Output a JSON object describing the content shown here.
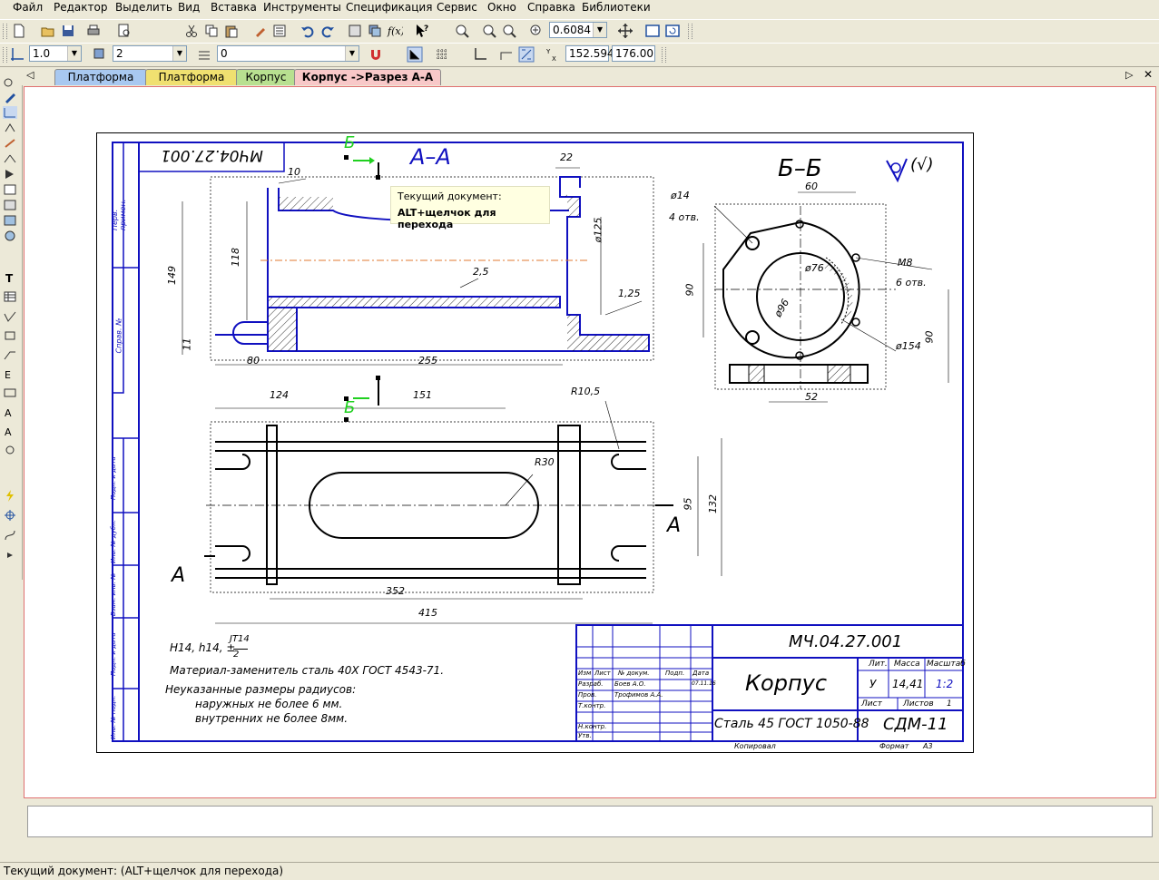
{
  "menu": {
    "items": [
      "Файл",
      "Редактор",
      "Выделить",
      "Вид",
      "Вставка",
      "Инструменты",
      "Спецификация",
      "Сервис",
      "Окно",
      "Справка",
      "Библиотеки"
    ]
  },
  "toolbar1": {
    "zoom_value": "0.6084"
  },
  "toolbar2": {
    "line_scale": "1.0",
    "layer": "2",
    "style": "0",
    "coord_x": "152.594",
    "coord_y": "176.00"
  },
  "tabs": [
    {
      "label": "Платформа",
      "color": "#a8c8f0"
    },
    {
      "label": "Платформа",
      "color": "#f0e070"
    },
    {
      "label": "Корпус",
      "color": "#b8e090"
    },
    {
      "label": "Корпус ->Разрез А-А",
      "color": "#f8c8c8"
    }
  ],
  "tooltip": {
    "line1": "Текущий документ:",
    "line2": "ALT+щелчок для перехода"
  },
  "drawing": {
    "doc_number_rotated": "МЧ04.27.001",
    "section_aa": "А–А",
    "section_bb": "Б–Б",
    "cut_label": "Б",
    "view_arrow_label": "А",
    "roughness": "(√)",
    "dims_top": {
      "d10": "10",
      "d22": "22",
      "d125": "ø125",
      "d118": "118",
      "d149": "149",
      "d25": "2,5",
      "d125b": "1,25",
      "d11": "11",
      "d80": "80",
      "d255": "255"
    },
    "dims_bb": {
      "d60": "60",
      "d14": "ø14",
      "d14b": "4 отв.",
      "d90l": "90",
      "d76": "ø76",
      "d96": "ø96",
      "m8": "М8",
      "m8b": "6 отв.",
      "d90r": "90",
      "d154": "ø154",
      "d52": "52"
    },
    "dims_bottom": {
      "d124": "124",
      "d151": "151",
      "r105": "R10,5",
      "r30": "R30",
      "d95": "95",
      "d132": "132",
      "d352": "352",
      "d415": "415"
    },
    "notes": {
      "tol": "H14, h14, ±",
      "tol_frac_top": "JT14",
      "tol_frac_bot": "2",
      "line2": "Материал-заменитель сталь 40Х ГОСТ 4543-71.",
      "line3": "Неуказанные размеры радиусов:",
      "line4": "наружных не более 6 мм.",
      "line5": "внутренних не более 8мм."
    },
    "side_labels": [
      "Перв. примен.",
      "Справ. №",
      "Подп. и дата",
      "Инв. № дубл.",
      "Взам. инв. №",
      "Подп. и дата",
      "Инв. № подл."
    ],
    "title_block": {
      "designation": "МЧ.04.27.001",
      "name": "Корпус",
      "material": "Сталь 45 ГОСТ 1050-88",
      "org": "СДМ-11",
      "lit_h": "Лит.",
      "mass_h": "Масса",
      "scale_h": "Масштаб",
      "lit": "У",
      "mass": "14,41",
      "scale": "1:2",
      "sheet_h": "Лист",
      "sheets_h": "Листов",
      "sheets": "1",
      "izm": "Изм",
      "list": "Лист",
      "ndoc": "№ докум.",
      "podp": "Подп.",
      "data": "Дата",
      "razrab": "Разраб.",
      "prov": "Пров.",
      "tkontr": "Т.контр.",
      "nkontr": "Н.контр.",
      "utv": "Утв.",
      "razrab_name": "Боев А.О.",
      "prov_name": "Трофимов А.А.",
      "date_val": "07.11.16",
      "copied": "Копировал",
      "format": "Формат",
      "format_val": "А3"
    }
  },
  "status": {
    "text": "Текущий документ:  (ALT+щелчок для перехода)"
  }
}
